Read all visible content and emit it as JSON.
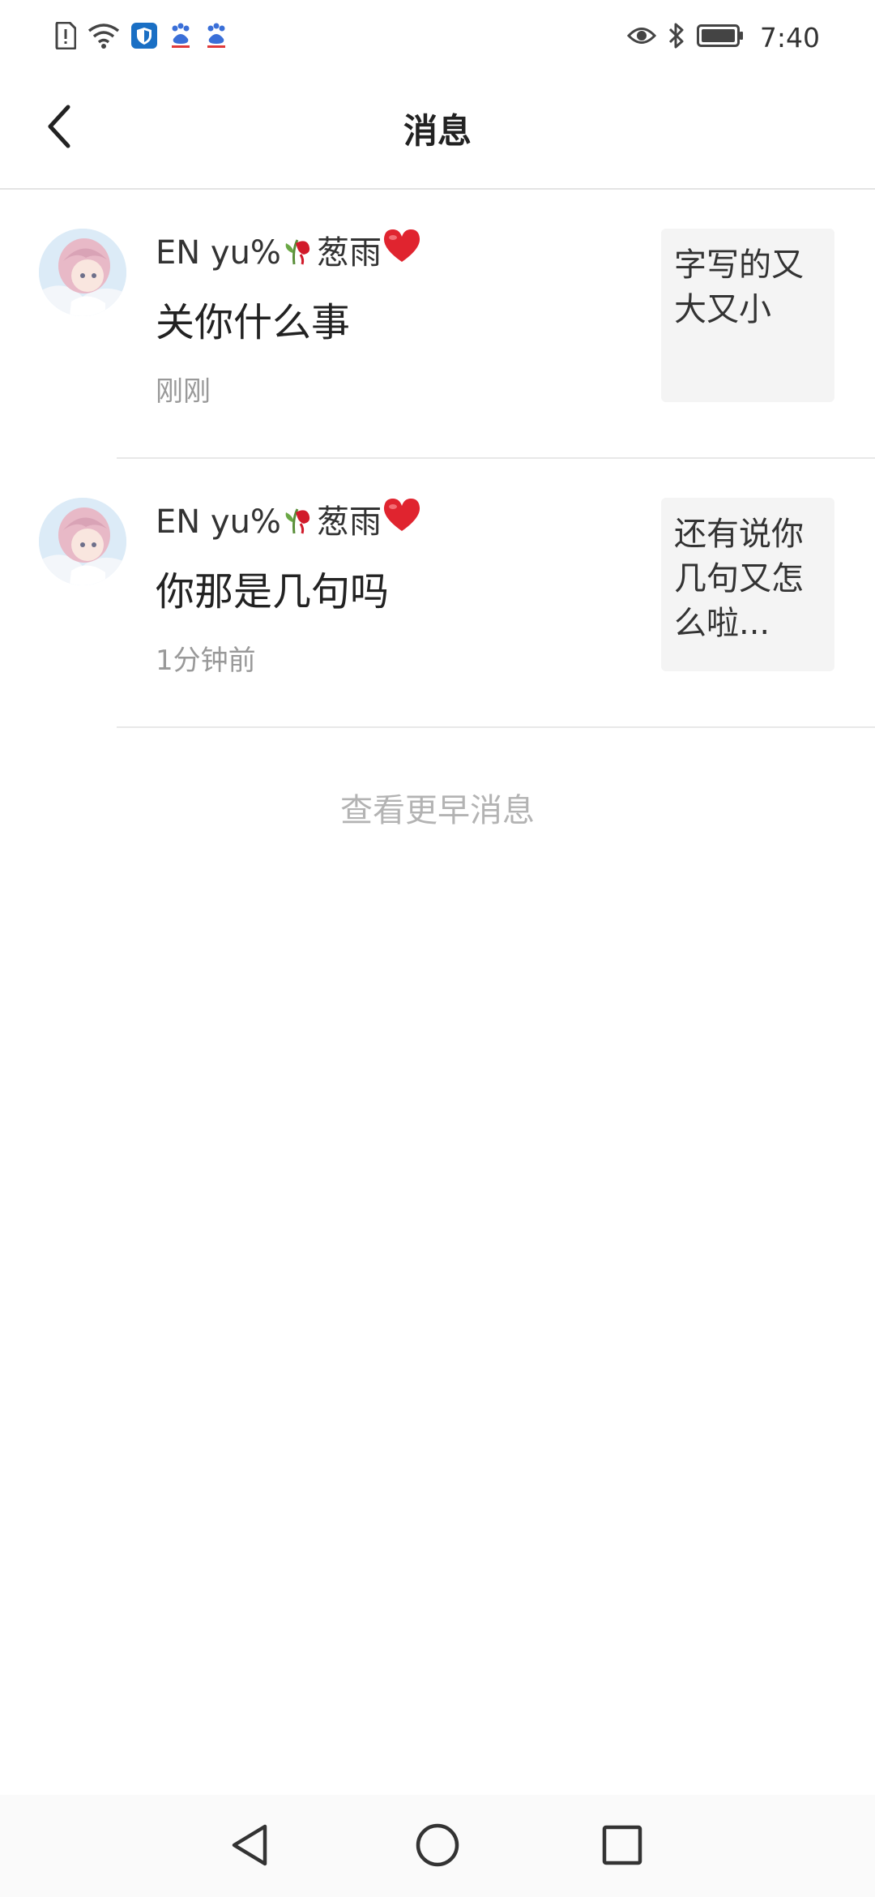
{
  "status_bar": {
    "time": "7:40",
    "left_icons": [
      "sim-alert-icon",
      "wifi-icon",
      "shield-app-icon",
      "baidu-paw-icon",
      "baidu-paw-icon"
    ],
    "right_icons": [
      "eye-icon",
      "bluetooth-icon",
      "battery-icon"
    ]
  },
  "header": {
    "title": "消息",
    "back_icon": "chevron-left-icon"
  },
  "messages": [
    {
      "name_text": "EN  yu%",
      "name_suffix": "葱雨",
      "name_emojis": [
        "wilted-rose-emoji",
        "red-heart-emoji"
      ],
      "text": "关你什么事",
      "time": "刚刚",
      "quote": "字写的又大又小"
    },
    {
      "name_text": "EN  yu%",
      "name_suffix": "葱雨",
      "name_emojis": [
        "wilted-rose-emoji",
        "red-heart-emoji"
      ],
      "text": "你那是几句吗",
      "time": "1分钟前",
      "quote": "还有说你几句又怎么啦..."
    }
  ],
  "load_earlier": "查看更早消息",
  "nav_bar": {
    "buttons": [
      "back-triangle-icon",
      "home-circle-icon",
      "recents-square-icon"
    ]
  },
  "colors": {
    "divider": "#e8e8e8",
    "muted_text": "#999999",
    "link_muted": "#b3b3b3",
    "quote_bg": "#f4f4f4",
    "heart": "#e0242f",
    "rose": "#d11a2a"
  }
}
